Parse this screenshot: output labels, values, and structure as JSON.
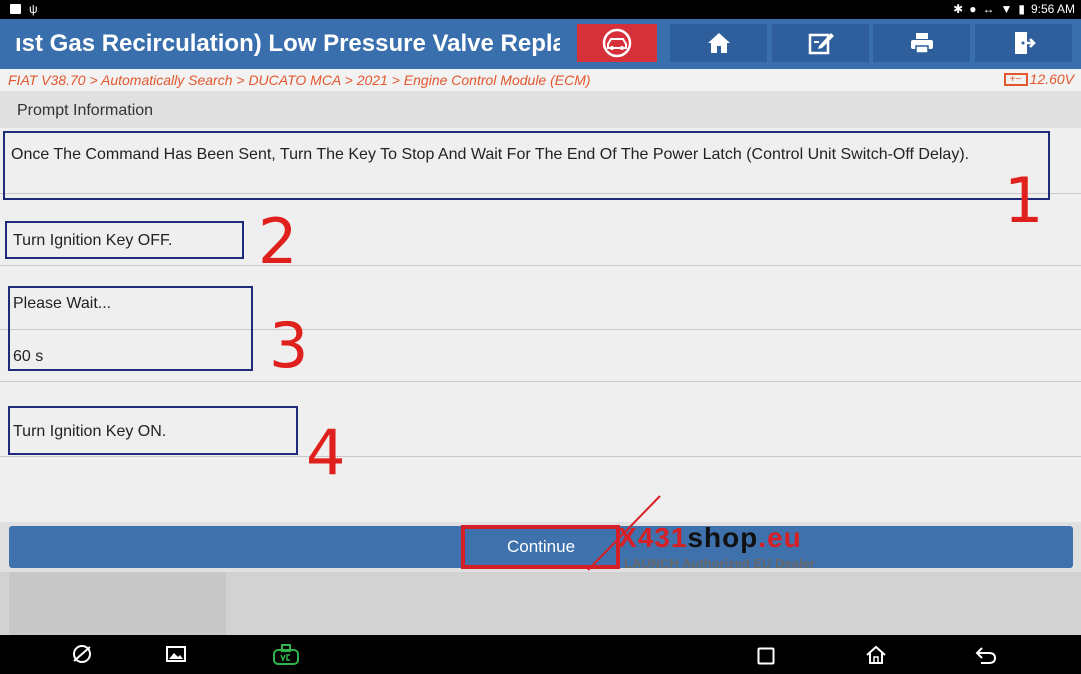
{
  "status_bar": {
    "icons_left": [
      "image-icon",
      "usb-icon"
    ],
    "icons_right": [
      "bluetooth-icon",
      "do-not-disturb-icon",
      "data-arrows-icon",
      "wifi-icon",
      "battery-icon"
    ],
    "time": "9:56 AM"
  },
  "header": {
    "title": "ıst Gas Recirculation) Low Pressure Valve Repla",
    "buttons": [
      "diagnose-button",
      "home-button",
      "report-button",
      "print-button",
      "exit-button"
    ]
  },
  "breadcrumb": {
    "path": "FIAT V38.70 > Automatically Search > DUCATO MCA > 2021 > Engine Control Module (ECM)",
    "voltage": "12.60V",
    "battery_glyph": "+−"
  },
  "prompt": {
    "header": "Prompt Information",
    "message": "Once The Command Has Been Sent, Turn The Key To Stop And Wait For The End Of The Power Latch (Control Unit Switch-Off Delay).",
    "steps": [
      {
        "text": "Turn Ignition Key OFF."
      },
      {
        "text": "Please Wait..."
      },
      {
        "text": "60 s"
      },
      {
        "text": "Turn Ignition Key ON."
      }
    ]
  },
  "annotations": [
    "1",
    "2",
    "3",
    "4"
  ],
  "continue_label": "Continue",
  "watermark": {
    "brand_x": "X",
    "brand_num": "431",
    "brand_shop": "shop",
    "brand_eu": ".eu",
    "tagline": "LAUNCH Authorized EU Dealer"
  },
  "colors": {
    "header_bg": "#3a6fae",
    "accent_red": "#d6303a",
    "breadcrumb_text": "#e4572e",
    "annotation_red": "#e0201c",
    "annotation_blue": "#1f2a7a"
  }
}
